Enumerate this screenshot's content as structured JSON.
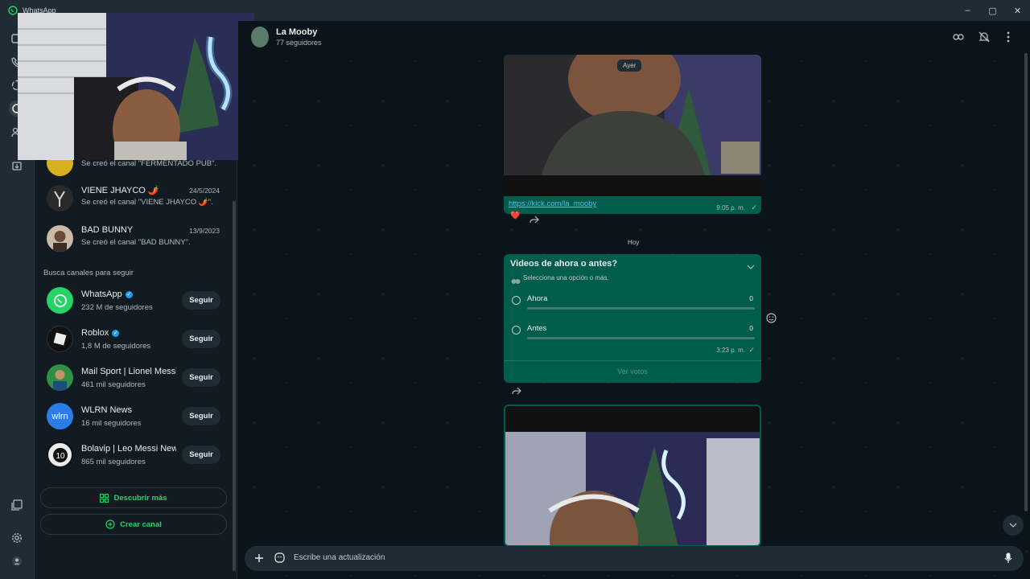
{
  "app": {
    "title": "WhatsApp"
  },
  "window_controls": {
    "minimize": "–",
    "maximize": "▢",
    "close": "✕"
  },
  "rail_icons": [
    "chats-icon",
    "calls-icon",
    "status-icon",
    "channels-icon",
    "communities-icon",
    "archived-icon",
    "media-icon",
    "settings-icon",
    "profile-icon"
  ],
  "channels": [
    {
      "name": "",
      "last": "Se creó el canal \"FERMENTADO PUB\".",
      "date": ""
    },
    {
      "name": "VIENE JHAYCO 🌶️",
      "last": "Se creó el canal \"VIENE JHAYCO 🌶️\".",
      "date": "24/5/2024"
    },
    {
      "name": "BAD BUNNY",
      "last": "Se creó el canal \"BAD BUNNY\".",
      "date": "13/9/2023"
    }
  ],
  "suggest_title": "Busca canales para seguir",
  "suggestions": [
    {
      "name": "WhatsApp",
      "verified": true,
      "followers": "232 M de seguidores",
      "button": "Seguir",
      "color": "#25d366"
    },
    {
      "name": "Roblox",
      "verified": true,
      "followers": "1,8 M de seguidores",
      "button": "Seguir",
      "color": "#111111"
    },
    {
      "name": "Mail Sport | Lionel Messi",
      "verified": false,
      "followers": "461 mil seguidores",
      "button": "Seguir",
      "color": "#2f8f45"
    },
    {
      "name": "WLRN News",
      "verified": false,
      "followers": "16 mil seguidores",
      "button": "Seguir",
      "color": "#2b7de9"
    },
    {
      "name": "Bolavip | Leo Messi News",
      "verified": false,
      "followers": "865 mil seguidores",
      "button": "Seguir",
      "color": "#e9edef"
    }
  ],
  "wlrn_logo_text": "wlrn",
  "discover_label": "Descubrir más",
  "create_label": "Crear canal",
  "chat": {
    "name": "La Mooby",
    "followers": "77 seguidores",
    "day_ayer": "Ayer",
    "link": "https://kick.com/la_mooby",
    "link_time": "9:05 p. m.",
    "reaction": "❤️",
    "day_hoy": "Hoy",
    "poll": {
      "question": "Videos de ahora o antes?",
      "hint": "Selecciona una opción o más.",
      "options": [
        {
          "label": "Ahora",
          "count": "0"
        },
        {
          "label": "Antes",
          "count": "0"
        }
      ],
      "time": "3:23 p. m.",
      "view_votes": "Ver votos"
    },
    "input_placeholder": "Escribe una actualización"
  }
}
